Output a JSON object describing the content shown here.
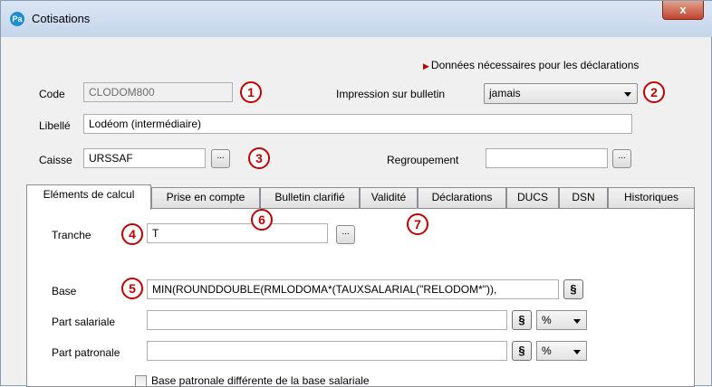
{
  "window": {
    "title": "Cotisations",
    "app_icon": "Pa",
    "close_label": "x"
  },
  "notice": "Données nécessaires pour les déclarations",
  "form": {
    "code_label": "Code",
    "code_value": "CLODOM800",
    "impression_label": "Impression sur bulletin",
    "impression_value": "jamais",
    "libelle_label": "Libellé",
    "libelle_value": "Lodéom (intermédiaire)",
    "caisse_label": "Caisse",
    "caisse_value": "URSSAF",
    "regroupement_label": "Regroupement",
    "regroupement_value": "",
    "browse_label": "..."
  },
  "tabs": [
    {
      "label": "Eléments de calcul",
      "active": true
    },
    {
      "label": "Prise en compte"
    },
    {
      "label": "Bulletin clarifié"
    },
    {
      "label": "Validité"
    },
    {
      "label": "Déclarations"
    },
    {
      "label": "DUCS"
    },
    {
      "label": "DSN"
    },
    {
      "label": "Historiques"
    }
  ],
  "calc": {
    "tranche_label": "Tranche",
    "tranche_value": "T",
    "base_label": "Base",
    "base_value": "MIN(ROUNDDOUBLE(RMLODOMA*(TAUXSALARIAL(\"RELODOM*\")),",
    "part_salariale_label": "Part salariale",
    "part_salariale_value": "",
    "part_patronale_label": "Part patronale",
    "part_patronale_value": "",
    "section_label": "§",
    "unit_label": "%",
    "checkbox_label": "Base patronale différente de la base salariale"
  },
  "annotations": [
    "1",
    "2",
    "3",
    "4",
    "5",
    "6",
    "7"
  ],
  "colors": {
    "annotation": "#c00000",
    "title_bar": "#c4d5ea",
    "close": "#c0442f"
  }
}
